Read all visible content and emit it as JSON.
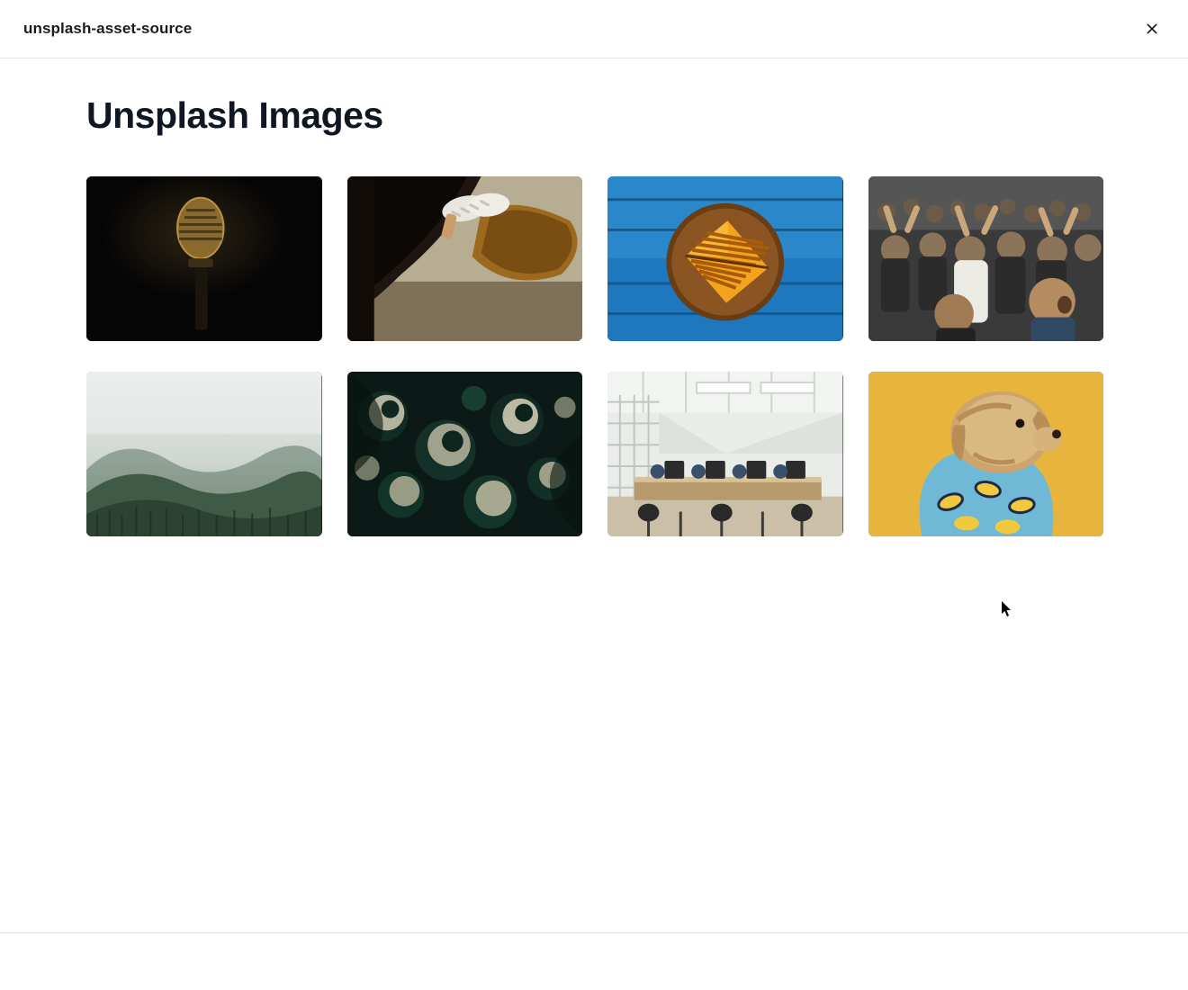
{
  "modal": {
    "title": "unsplash-asset-source"
  },
  "page": {
    "heading": "Unsplash Images"
  },
  "images": [
    {
      "name": "microphone-dark"
    },
    {
      "name": "feet-out-car-window"
    },
    {
      "name": "grilled-sandwich-plate"
    },
    {
      "name": "cheering-crowd"
    },
    {
      "name": "foggy-forest"
    },
    {
      "name": "abstract-liquid-bubbles"
    },
    {
      "name": "open-office-space"
    },
    {
      "name": "dog-yellow-background"
    }
  ]
}
